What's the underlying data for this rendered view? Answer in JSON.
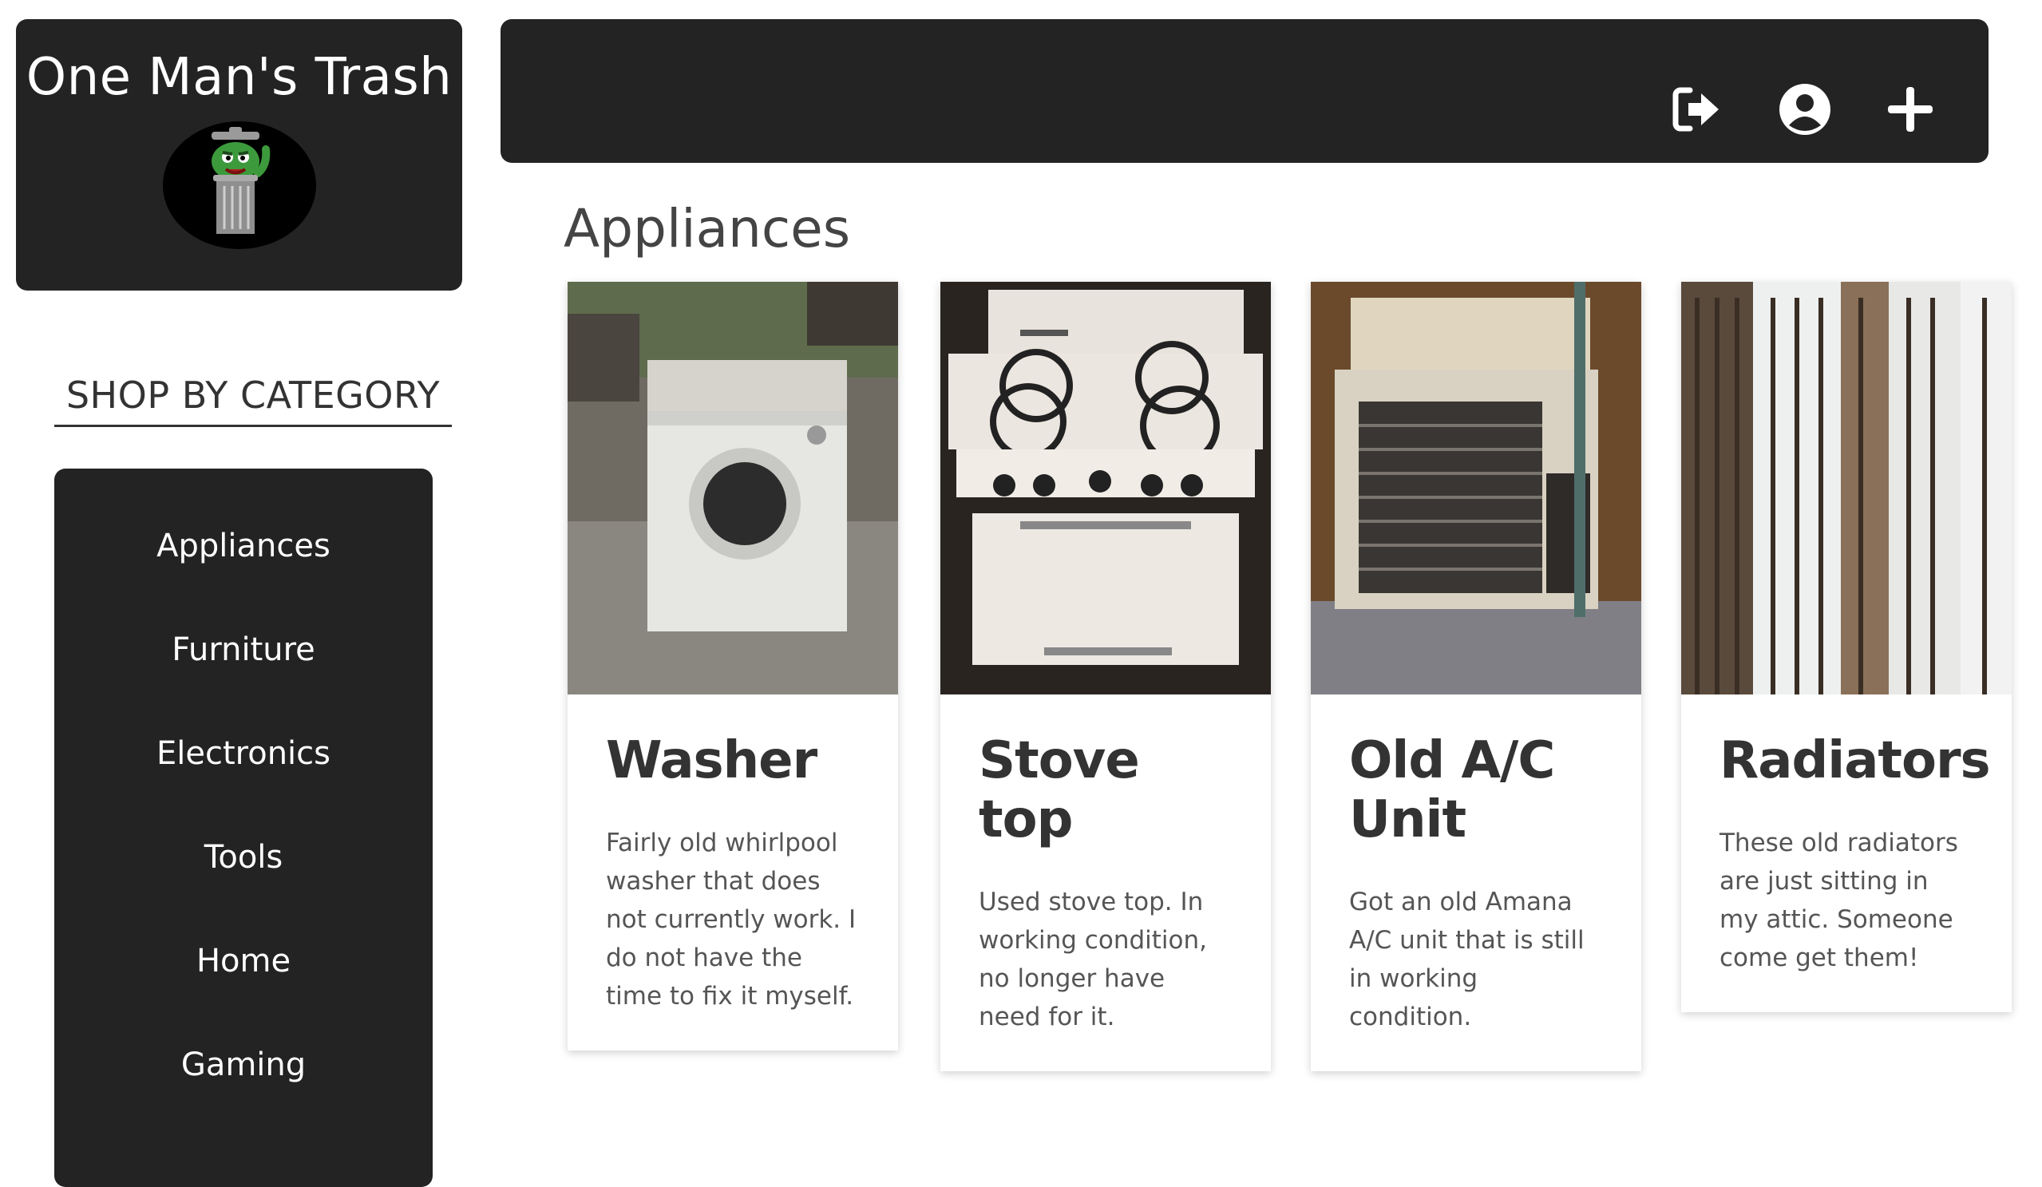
{
  "brand": {
    "title": "One Man's Trash",
    "avatar_icon": "trash-can-monster-icon"
  },
  "topbar": {
    "icons": [
      {
        "name": "logout-icon"
      },
      {
        "name": "account-icon"
      },
      {
        "name": "add-icon"
      }
    ]
  },
  "sidebar": {
    "heading": "SHOP BY CATEGORY",
    "items": [
      {
        "label": "Appliances"
      },
      {
        "label": "Furniture"
      },
      {
        "label": "Electronics"
      },
      {
        "label": "Tools"
      },
      {
        "label": "Home"
      },
      {
        "label": "Gaming"
      }
    ]
  },
  "main": {
    "section_title": "Appliances",
    "listings": [
      {
        "title": "Washer",
        "description": "Fairly old whirlpool washer that does not currently work. I do not have the time to fix it myself.",
        "image": "washer-photo"
      },
      {
        "title": "Stove top",
        "description": "Used stove top. In working condition, no longer have need for it.",
        "image": "stove-photo"
      },
      {
        "title": "Old A/C Unit",
        "description": "Got an old Amana A/C unit that is still in working condition.",
        "image": "ac-unit-photo"
      },
      {
        "title": "Radiators",
        "description": "These old radiators are just sitting in my attic. Someone come get them!",
        "image": "radiators-photo"
      }
    ]
  },
  "colors": {
    "dark_panel": "#232323",
    "text": "#333333",
    "page_bg": "#ffffff"
  }
}
